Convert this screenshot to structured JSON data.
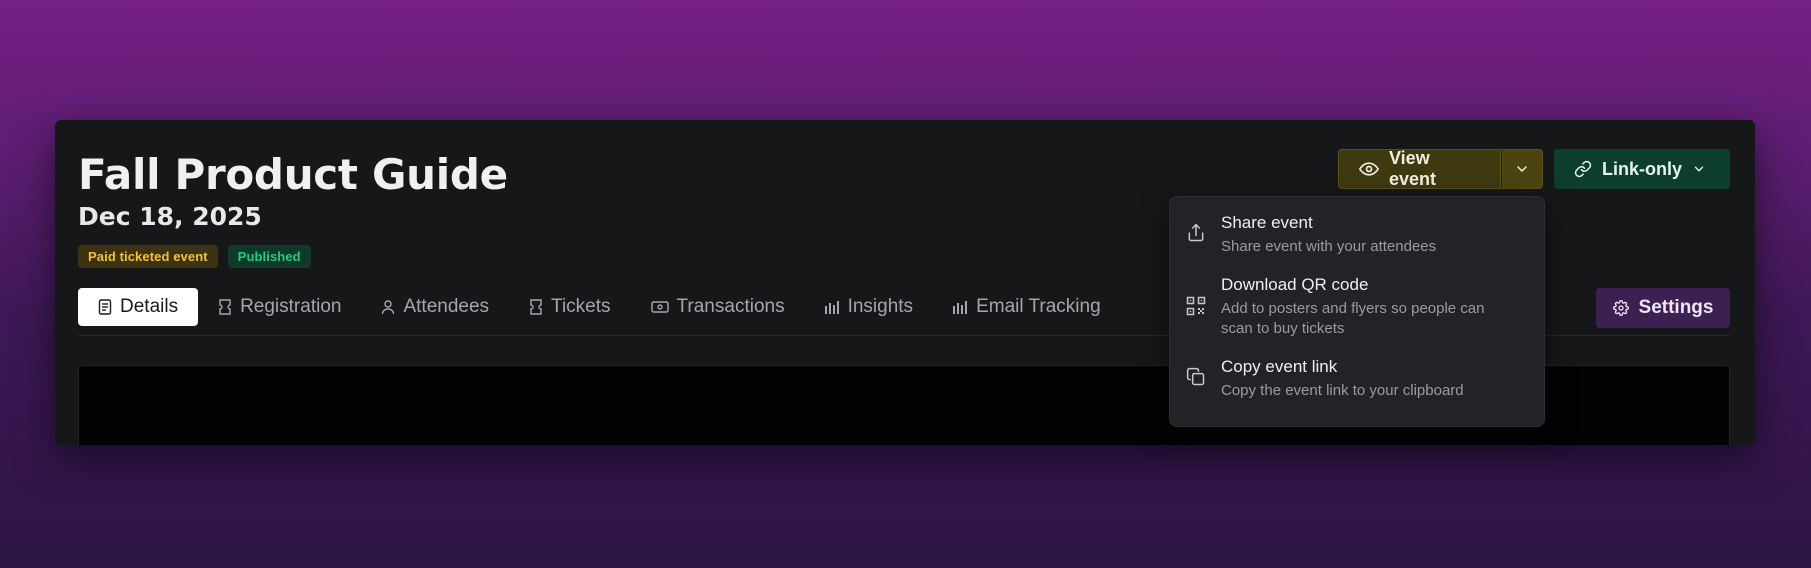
{
  "event": {
    "title": "Fall Product Guide",
    "date": "Dec 18, 2025",
    "badges": [
      {
        "label": "Paid ticketed event",
        "color": "#f2c230"
      },
      {
        "label": "Published",
        "color": "#27c985"
      }
    ]
  },
  "actions": {
    "view_event": "View event",
    "link_only": "Link-only"
  },
  "tabs": [
    {
      "label": "Details",
      "icon": "document-icon",
      "active": true
    },
    {
      "label": "Registration",
      "icon": "ticket-icon"
    },
    {
      "label": "Attendees",
      "icon": "user-icon"
    },
    {
      "label": "Tickets",
      "icon": "ticket-icon"
    },
    {
      "label": "Transactions",
      "icon": "money-icon"
    },
    {
      "label": "Insights",
      "icon": "bar-chart-icon"
    },
    {
      "label": "Email Tracking",
      "icon": "bar-chart-icon"
    }
  ],
  "settings_label": "Settings",
  "dropdown": {
    "items": [
      {
        "title": "Share event",
        "desc": "Share event with your attendees",
        "icon": "share-icon"
      },
      {
        "title": "Download QR code",
        "desc": "Add to posters and flyers so people can scan to buy tickets",
        "icon": "qr-code-icon"
      },
      {
        "title": "Copy event link",
        "desc": "Copy the event link to your clipboard",
        "icon": "copy-icon"
      }
    ]
  },
  "colors": {
    "background_top": "#761f84",
    "card": "#161719",
    "view_button": "#3f3910",
    "link_button": "#0d3d2d",
    "settings_button": "#3c2051"
  }
}
